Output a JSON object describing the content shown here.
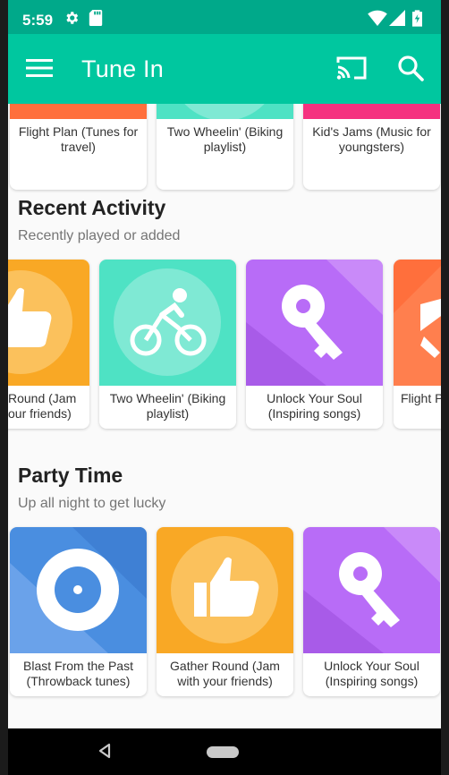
{
  "status_bar": {
    "time": "5:59"
  },
  "app_bar": {
    "title": "Tune In"
  },
  "colors": {
    "status_bar": "#00a98a",
    "app_bar": "#00c79f",
    "orange": "#f9a825",
    "teal": "#4ee2c4",
    "purple": "#b86cf7",
    "red_orange": "#ff6f3c",
    "pink": "#f5317f",
    "blue": "#4a8ee0"
  },
  "top_row": {
    "cards": [
      {
        "caption": "Flight Plan (Tunes for travel)",
        "icon": "airplane-icon"
      },
      {
        "caption": "Two Wheelin' (Biking playlist)",
        "icon": "bike-icon"
      },
      {
        "caption": "Kid's Jams (Music for youngsters)",
        "icon": "music-icon"
      }
    ]
  },
  "recent": {
    "title": "Recent Activity",
    "subtitle": "Recently played or added",
    "cards": [
      {
        "caption": "Gather Round (Jam with your friends)",
        "visible_caption_1": "Round (Jam",
        "visible_caption_2": "our friends)",
        "icon": "thumbs-up-icon"
      },
      {
        "caption_1": "Two Wheelin' (Biking",
        "caption_2": "playlist)",
        "icon": "bike-icon"
      },
      {
        "caption_1": "Unlock Your Soul",
        "caption_2": "(Inspiring songs)",
        "icon": "key-icon"
      },
      {
        "caption_1": "Flight P",
        "icon": "airplane-icon"
      }
    ]
  },
  "party": {
    "title": "Party Time",
    "subtitle": "Up all night to get lucky",
    "cards": [
      {
        "caption_1": "Blast From the Past",
        "caption_2": "(Throwback tunes)",
        "icon": "vinyl-icon"
      },
      {
        "caption_1": "Gather Round (Jam",
        "caption_2": "with your friends)",
        "icon": "thumbs-up-icon"
      },
      {
        "caption_1": "Unlock Your Soul",
        "caption_2": "(Inspiring songs)",
        "icon": "key-icon"
      }
    ]
  }
}
